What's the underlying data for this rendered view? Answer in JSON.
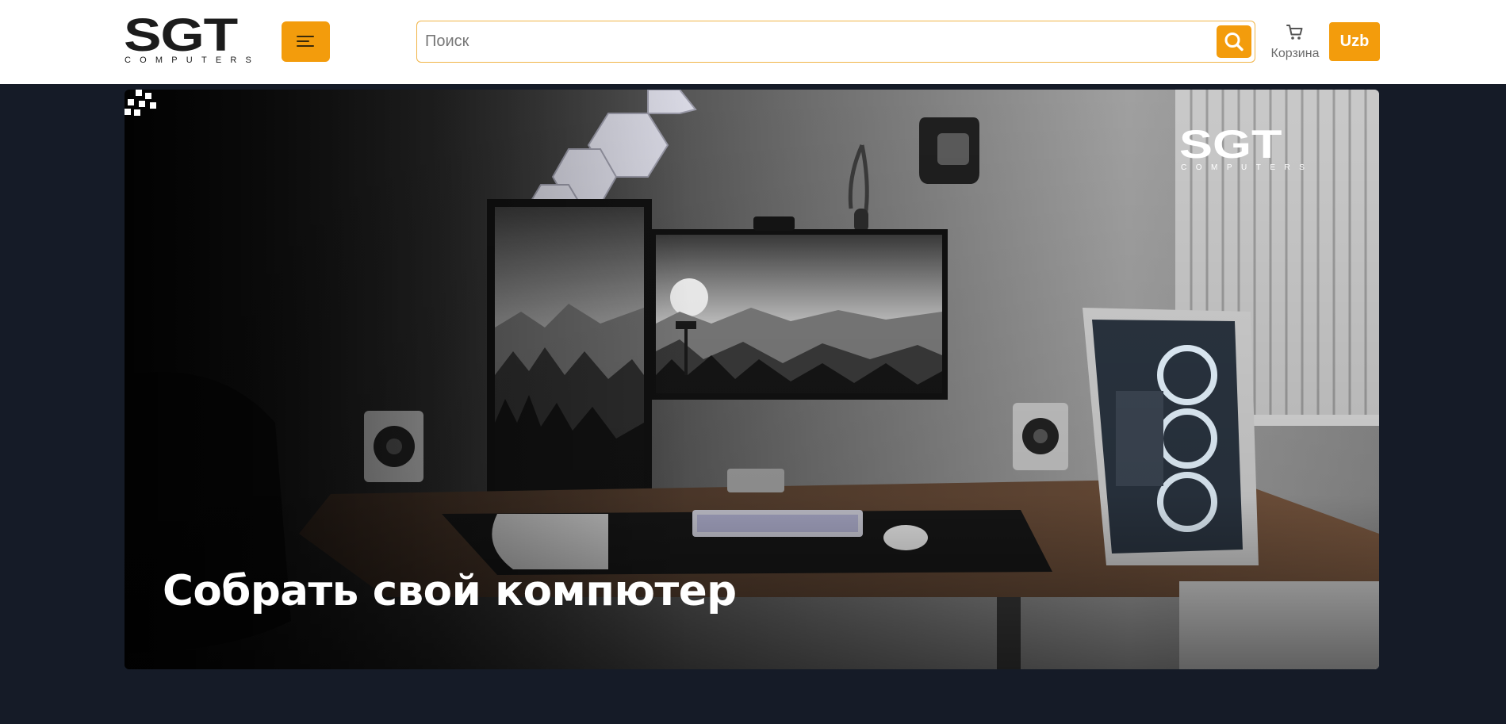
{
  "header": {
    "logo": {
      "main": "SGT",
      "sub": "COMPUTERS"
    },
    "menu_icon": "hamburger-menu-icon",
    "search": {
      "placeholder": "Поиск",
      "value": "",
      "icon": "search-icon"
    },
    "cart": {
      "label": "Корзина",
      "icon": "cart-icon"
    },
    "language": {
      "label": "Uzb"
    }
  },
  "banner": {
    "title": "Собрать свой компютер",
    "watermark": {
      "main": "SGT",
      "sub": "COMPUTERS"
    }
  },
  "colors": {
    "accent": "#f39c0c",
    "page_background": "#151b27",
    "header_background": "#ffffff",
    "text_dark": "#1c1c1c"
  }
}
